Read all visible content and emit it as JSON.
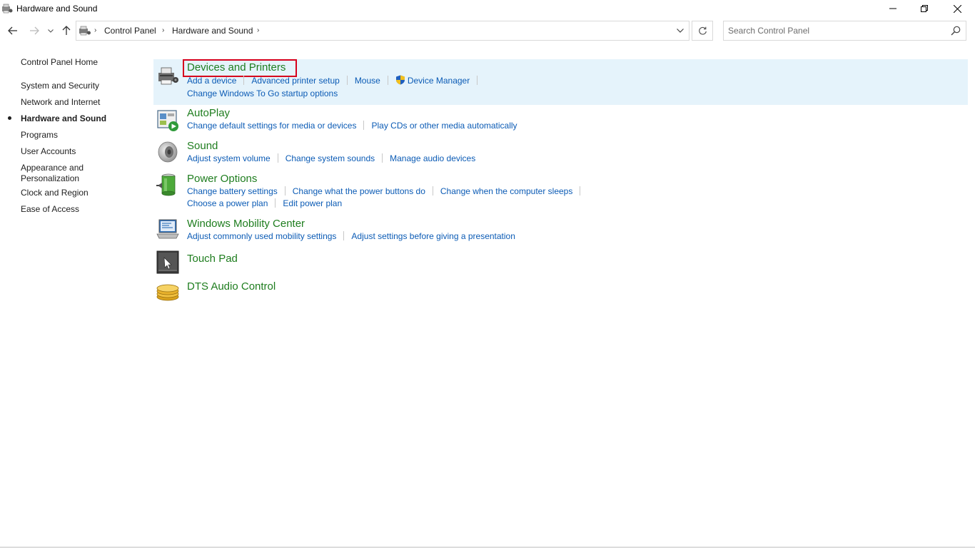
{
  "window": {
    "title": "Hardware and Sound"
  },
  "address": {
    "crumbs": [
      "Control Panel",
      "Hardware and Sound"
    ]
  },
  "search": {
    "placeholder": "Search Control Panel"
  },
  "leftnav": {
    "home": "Control Panel Home",
    "items": [
      "System and Security",
      "Network and Internet",
      "Hardware and Sound",
      "Programs",
      "User Accounts",
      "Appearance and Personalization",
      "Clock and Region",
      "Ease of Access"
    ],
    "current_index": 2
  },
  "categories": [
    {
      "title": "Devices and Printers",
      "icon": "printer-icon",
      "links": [
        "Add a device",
        "Advanced printer setup",
        "Mouse",
        "Device Manager"
      ],
      "links2": [
        "Change Windows To Go startup options"
      ]
    },
    {
      "title": "AutoPlay",
      "icon": "autoplay-icon",
      "links": [
        "Change default settings for media or devices",
        "Play CDs or other media automatically"
      ]
    },
    {
      "title": "Sound",
      "icon": "speaker-icon",
      "links": [
        "Adjust system volume",
        "Change system sounds",
        "Manage audio devices"
      ]
    },
    {
      "title": "Power Options",
      "icon": "battery-icon",
      "links": [
        "Change battery settings",
        "Change what the power buttons do",
        "Change when the computer sleeps"
      ],
      "links2": [
        "Choose a power plan",
        "Edit power plan"
      ]
    },
    {
      "title": "Windows Mobility Center",
      "icon": "mobility-center-icon",
      "links": [
        "Adjust commonly used mobility settings",
        "Adjust settings before giving a presentation"
      ]
    },
    {
      "title": "Touch Pad",
      "icon": "touchpad-icon"
    },
    {
      "title": "DTS Audio Control",
      "icon": "dts-audio-icon"
    }
  ],
  "colors": {
    "category_title": "#1e7d1e",
    "link": "#0b5bb5",
    "highlight_bg": "#e5f3fb",
    "annotation_box": "#d6001c"
  }
}
